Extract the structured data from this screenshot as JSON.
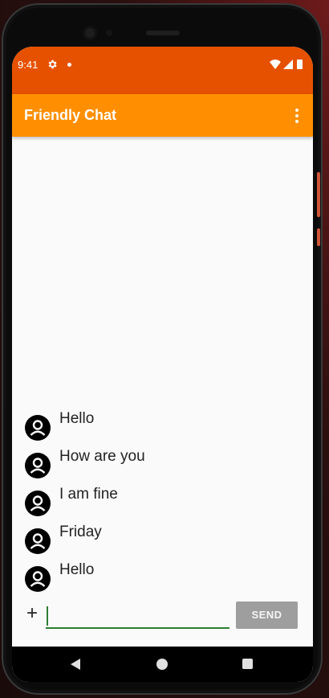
{
  "status_bar": {
    "time": "9:41",
    "icons": [
      "gear-icon",
      "notification-dot-icon",
      "wifi-icon",
      "signal-icon",
      "battery-icon"
    ]
  },
  "app_bar": {
    "title": "Friendly Chat",
    "menu_icon": "more-vert-icon"
  },
  "colors": {
    "status_bar": "#e65100",
    "app_bar": "#ff8f00",
    "input_underline": "#2e7d32",
    "send_button": "#9e9e9e",
    "background": "#fafafa"
  },
  "messages": [
    {
      "text": "Hello",
      "avatar": "account-circle-icon"
    },
    {
      "text": "How are you",
      "avatar": "account-circle-icon"
    },
    {
      "text": "I am fine",
      "avatar": "account-circle-icon"
    },
    {
      "text": "Friday",
      "avatar": "account-circle-icon"
    },
    {
      "text": "Hello",
      "avatar": "account-circle-icon"
    }
  ],
  "composer": {
    "add_label": "+",
    "input_value": "",
    "input_placeholder": "",
    "send_label": "SEND"
  },
  "nav_bar": {
    "icons": [
      "back-icon",
      "home-icon",
      "recents-icon"
    ]
  }
}
